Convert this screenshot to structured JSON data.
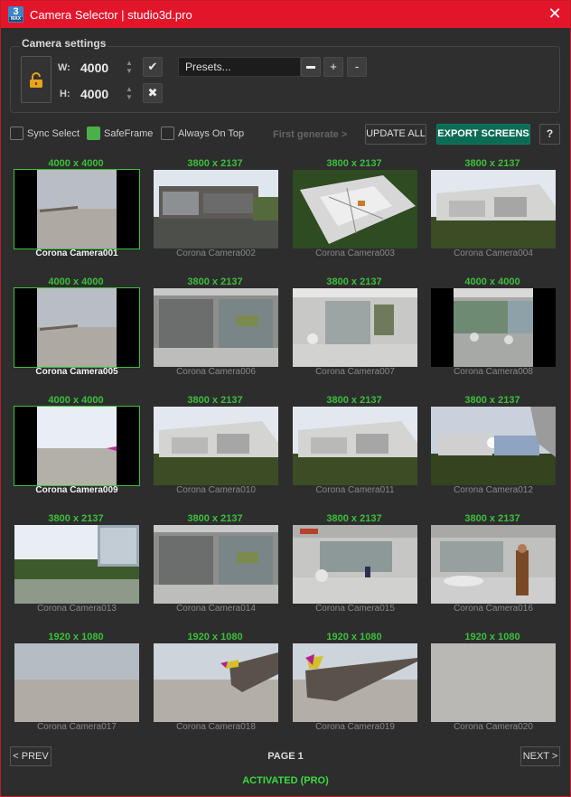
{
  "window": {
    "icon_number": "3",
    "icon_sub": "MAX",
    "title": "Camera Selector | studio3d.pro",
    "close_icon": "close-icon"
  },
  "settings": {
    "group_title": "Camera settings",
    "lock_icon": "unlock-icon",
    "width_label": "W:",
    "width_value": "4000",
    "height_label": "H:",
    "height_value": "4000",
    "apply_icon": "checkmark-icon",
    "cancel_icon": "x-icon",
    "presets_placeholder": "Presets...",
    "preset_minus_square": "▬",
    "preset_add": "+",
    "preset_remove": "-"
  },
  "toolbar": {
    "sync_select": {
      "label": "Sync Select",
      "checked": false
    },
    "safe_frame": {
      "label": "SafeFrame",
      "checked": true
    },
    "always_on_top": {
      "label": "Always On Top",
      "checked": false
    },
    "first_generate": "First generate >",
    "update_all": "UPDATE ALL",
    "export_screens": "EXPORT SCREENS",
    "help": "?"
  },
  "cameras": [
    {
      "res": "4000 x 4000",
      "name": "Corona Camera001",
      "selected": true,
      "scene": "square-horizon"
    },
    {
      "res": "3800 x 2137",
      "name": "Corona Camera002",
      "selected": false,
      "scene": "exterior-night"
    },
    {
      "res": "3800 x 2137",
      "name": "Corona Camera003",
      "selected": false,
      "scene": "aerial"
    },
    {
      "res": "3800 x 2137",
      "name": "Corona Camera004",
      "selected": false,
      "scene": "exterior-white"
    },
    {
      "res": "4000 x 4000",
      "name": "Corona Camera005",
      "selected": true,
      "scene": "square-horizon"
    },
    {
      "res": "3800 x 2137",
      "name": "Corona Camera006",
      "selected": false,
      "scene": "interior-glass"
    },
    {
      "res": "3800 x 2137",
      "name": "Corona Camera007",
      "selected": false,
      "scene": "interior-hall"
    },
    {
      "res": "4000 x 4000",
      "name": "Corona Camera008",
      "selected": false,
      "scene": "square-interior"
    },
    {
      "res": "4000 x 4000",
      "name": "Corona Camera009",
      "selected": true,
      "scene": "square-sky"
    },
    {
      "res": "3800 x 2137",
      "name": "Corona Camera010",
      "selected": false,
      "scene": "exterior-white"
    },
    {
      "res": "3800 x 2137",
      "name": "Corona Camera011",
      "selected": false,
      "scene": "exterior-white"
    },
    {
      "res": "3800 x 2137",
      "name": "Corona Camera012",
      "selected": false,
      "scene": "exterior-sky"
    },
    {
      "res": "3800 x 2137",
      "name": "Corona Camera013",
      "selected": false,
      "scene": "trees"
    },
    {
      "res": "3800 x 2137",
      "name": "Corona Camera014",
      "selected": false,
      "scene": "interior-glass"
    },
    {
      "res": "3800 x 2137",
      "name": "Corona Camera015",
      "selected": false,
      "scene": "interior-red"
    },
    {
      "res": "3800 x 2137",
      "name": "Corona Camera016",
      "selected": false,
      "scene": "interior-person"
    },
    {
      "res": "1920 x 1080",
      "name": "Corona Camera017",
      "selected": false,
      "scene": "plain-horizon"
    },
    {
      "res": "1920 x 1080",
      "name": "Corona Camera018",
      "selected": false,
      "scene": "plain-object"
    },
    {
      "res": "1920 x 1080",
      "name": "Corona Camera019",
      "selected": false,
      "scene": "plain-object2"
    },
    {
      "res": "1920 x 1080",
      "name": "Corona Camera020",
      "selected": false,
      "scene": "blank"
    }
  ],
  "footer": {
    "prev": "< PREV",
    "page": "PAGE 1",
    "next": "NEXT >",
    "activated": "ACTIVATED (PRO)"
  },
  "colors": {
    "titlebar": "#e3152b",
    "accent_green": "#3cbf3c",
    "export_button": "#0b6b54"
  }
}
